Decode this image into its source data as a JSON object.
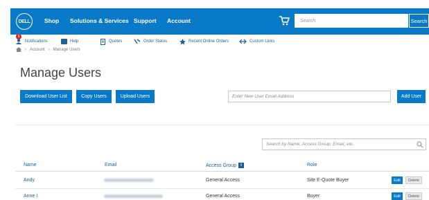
{
  "header": {
    "logo_text": "DELL",
    "nav": [
      {
        "label": "Shop"
      },
      {
        "label": "Solutions & Services"
      },
      {
        "label": "Support"
      },
      {
        "label": "Account"
      }
    ],
    "search_placeholder": "Search",
    "search_button": "Search",
    "brand_color": "#0a79c8"
  },
  "utility_bar": {
    "notifications_count": "1",
    "items": [
      {
        "label": "Notifications",
        "icon": "user-icon"
      },
      {
        "label": "Help",
        "icon": "help-icon"
      },
      {
        "label": "Quotes",
        "icon": "document-icon"
      },
      {
        "label": "Order Status",
        "icon": "truck-icon"
      },
      {
        "label": "Recent Online Orders",
        "icon": "star-icon"
      },
      {
        "label": "Custom Links",
        "icon": "link-icon"
      }
    ]
  },
  "breadcrumb": [
    "Account",
    "Manage Users"
  ],
  "page": {
    "title": "Manage Users",
    "download_label": "Download User List",
    "copy_label": "Copy Users",
    "upload_label": "Upload Users",
    "new_email_placeholder": "Enter New User Email Address",
    "add_user_label": "Add User",
    "filter_placeholder": "Search by Name, Access Group, Email, etc."
  },
  "table": {
    "columns": {
      "name": "Name",
      "email": "Email",
      "access_group": "Access Group",
      "access_group_info": "i",
      "role": "Role"
    },
    "rows": [
      {
        "name": "Andy",
        "access_group": "General Access",
        "role": "Site E-Quote Buyer",
        "edit": "Edit",
        "delete": "Delete"
      },
      {
        "name": "Anne I",
        "access_group": "General Access",
        "role": "Buyer",
        "edit": "Edit",
        "delete": "Delete"
      }
    ]
  }
}
